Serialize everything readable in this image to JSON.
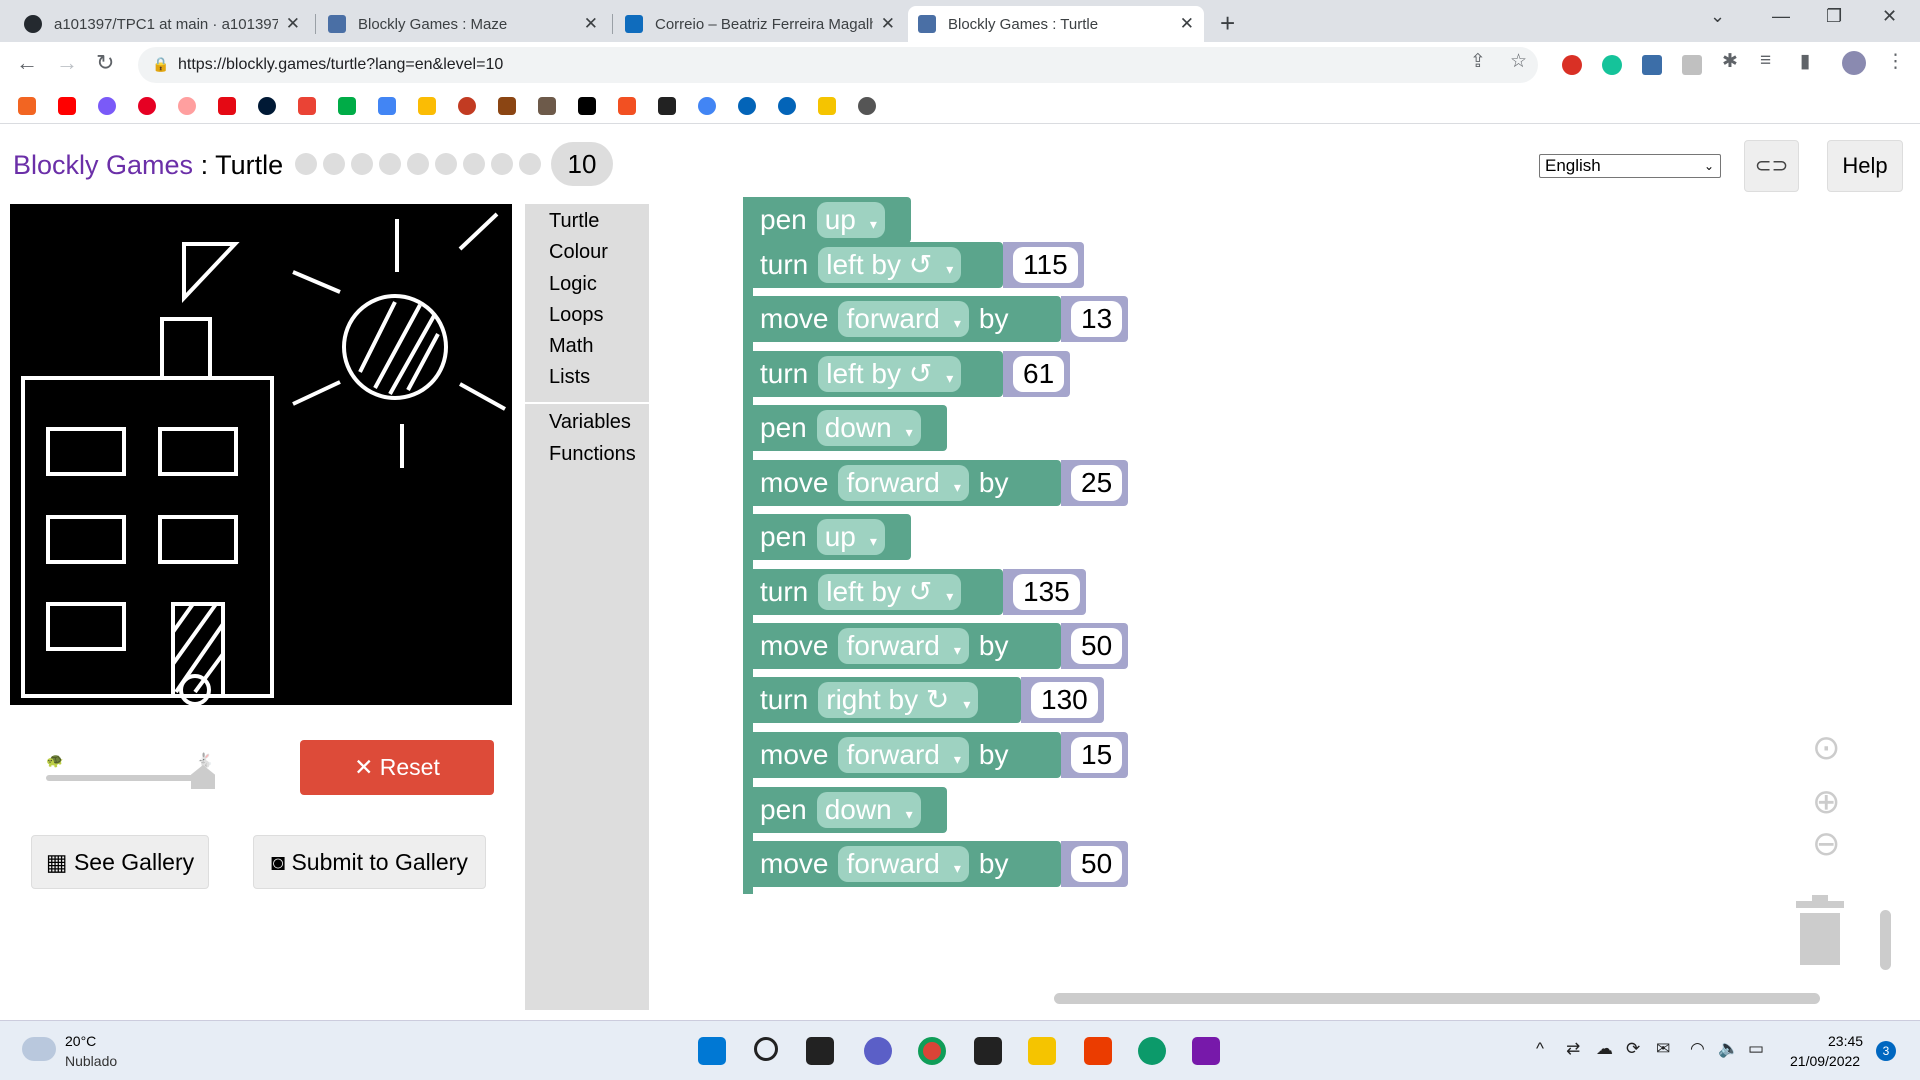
{
  "browser": {
    "tabs": [
      {
        "title": "a101397/TPC1 at main · a101397",
        "active": false
      },
      {
        "title": "Blockly Games : Maze",
        "active": false
      },
      {
        "title": "Correio – Beatriz Ferreira Magalhães",
        "active": false
      },
      {
        "title": "Blockly Games : Turtle",
        "active": true
      }
    ],
    "url": "https://blockly.games/turtle?lang=en&level=10"
  },
  "page": {
    "brand": "Blockly Games",
    "separator": " : ",
    "game": "Turtle",
    "level": "10",
    "language": "English",
    "help_label": "Help",
    "reset_label": "Reset",
    "gallery_label": "See Gallery",
    "submit_label": "Submit to Gallery"
  },
  "toolbox": {
    "categories": [
      "Turtle",
      "Colour",
      "Logic",
      "Loops",
      "Math",
      "Lists",
      "Variables",
      "Functions"
    ]
  },
  "blocks": [
    {
      "kind": "pen",
      "keyword": "pen",
      "option": "up"
    },
    {
      "kind": "turn",
      "keyword": "turn",
      "option": "left by ↺",
      "value": "115"
    },
    {
      "kind": "move",
      "keyword": "move",
      "option": "forward",
      "by": "by",
      "value": "13"
    },
    {
      "kind": "turn",
      "keyword": "turn",
      "option": "left by ↺",
      "value": "61"
    },
    {
      "kind": "pen",
      "keyword": "pen",
      "option": "down"
    },
    {
      "kind": "move",
      "keyword": "move",
      "option": "forward",
      "by": "by",
      "value": "25"
    },
    {
      "kind": "pen",
      "keyword": "pen",
      "option": "up"
    },
    {
      "kind": "turn",
      "keyword": "turn",
      "option": "left by ↺",
      "value": "135"
    },
    {
      "kind": "move",
      "keyword": "move",
      "option": "forward",
      "by": "by",
      "value": "50"
    },
    {
      "kind": "turn",
      "keyword": "turn",
      "option": "right by ↻",
      "value": "130"
    },
    {
      "kind": "move",
      "keyword": "move",
      "option": "forward",
      "by": "by",
      "value": "15"
    },
    {
      "kind": "pen",
      "keyword": "pen",
      "option": "down"
    },
    {
      "kind": "move",
      "keyword": "move",
      "option": "forward",
      "by": "by",
      "value": "50"
    }
  ],
  "taskbar": {
    "temperature": "20°C",
    "weather": "Nublado",
    "time": "23:45",
    "date": "21/09/2022",
    "notifications": "3"
  },
  "colors": {
    "block_turtle": "#5ba58c",
    "block_math": "#a5a5cc",
    "reset": "#dd4b39",
    "brand": "#6b2fa8"
  }
}
